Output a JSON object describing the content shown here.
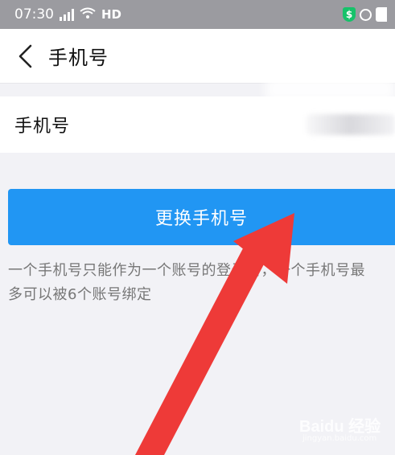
{
  "status_bar": {
    "time": "07:30",
    "network_label": "HD",
    "shield_glyph": "$",
    "icons": [
      "signal-icon",
      "wifi-icon",
      "shield-icon",
      "alarm-icon",
      "battery-icon"
    ]
  },
  "header": {
    "title": "手机号",
    "back_icon": "chevron-left-icon"
  },
  "phone_row": {
    "label": "手机号"
  },
  "primary_button": {
    "label": "更换手机号",
    "color": "#2196f3"
  },
  "note": {
    "text": "一个手机号只能作为一个账号的登录名，一个手机号最\n多可以被6个账号绑定"
  },
  "watermark": {
    "text": "Baidu 经验",
    "sub": "jingyan.baidu.com"
  },
  "annotation": {
    "arrow_color": "#ee3a38"
  }
}
